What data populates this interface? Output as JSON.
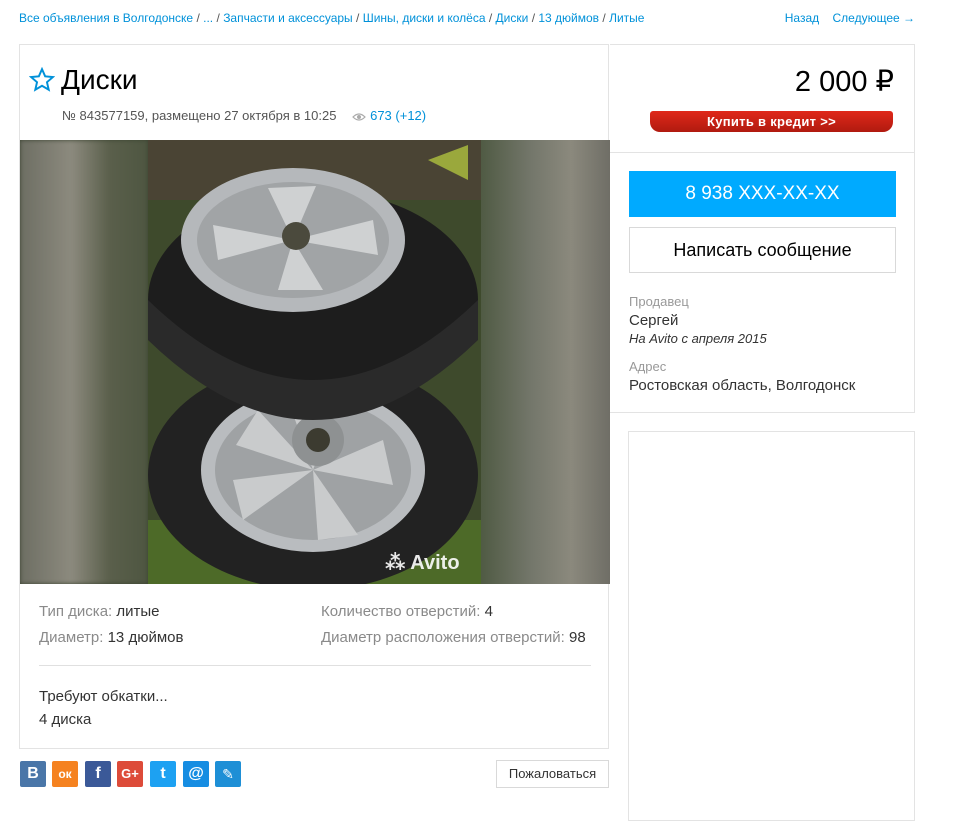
{
  "breadcrumbs": [
    "Все объявления в Волгодонске",
    "...",
    "Запчасти и аксессуары",
    "Шины, диски и колёса",
    "Диски",
    "13 дюймов",
    "Литые"
  ],
  "nav": {
    "back": "Назад",
    "next": "Следующее →"
  },
  "listing": {
    "title": "Диски",
    "meta": "№ 843577159, размещено 27 октября в 10:25",
    "views": "673 (+12)",
    "price": "2 000 ₽",
    "credit_button": "Купить в кредит >>",
    "watermark": "Avito"
  },
  "contact": {
    "phone_button": "8 938 XXX-XX-XX",
    "message_button": "Написать сообщение",
    "seller_label": "Продавец",
    "seller_name": "Сергей",
    "seller_since": "На Avito с апреля 2015",
    "address_label": "Адрес",
    "address": "Ростовская область, Волгодонск"
  },
  "params": [
    {
      "key": "Тип диска:",
      "value": "литые"
    },
    {
      "key": "Количество отверстий:",
      "value": "4"
    },
    {
      "key": "Диаметр:",
      "value": "13 дюймов"
    },
    {
      "key": "Диаметр расположения отверстий:",
      "value": "98"
    }
  ],
  "description": [
    "Требуют обкатки...",
    "4 диска"
  ],
  "share": [
    {
      "icon": "vk-icon",
      "glyph": "В",
      "color": "#4a76a8"
    },
    {
      "icon": "odnoklassniki-icon",
      "glyph": "ок",
      "color": "#f58220"
    },
    {
      "icon": "facebook-icon",
      "glyph": "f",
      "color": "#3b5998"
    },
    {
      "icon": "google-plus-icon",
      "glyph": "G+",
      "color": "#dd4b39"
    },
    {
      "icon": "twitter-icon",
      "glyph": "t",
      "color": "#1da1f2"
    },
    {
      "icon": "mail-icon",
      "glyph": "@",
      "color": "#168de2"
    },
    {
      "icon": "livejournal-icon",
      "glyph": "✎",
      "color": "#1e8fd6"
    }
  ],
  "complain_button": "Пожаловаться",
  "colors": {
    "accent": "#00aaff",
    "link": "#0091d9",
    "credit": "#d0241a"
  }
}
